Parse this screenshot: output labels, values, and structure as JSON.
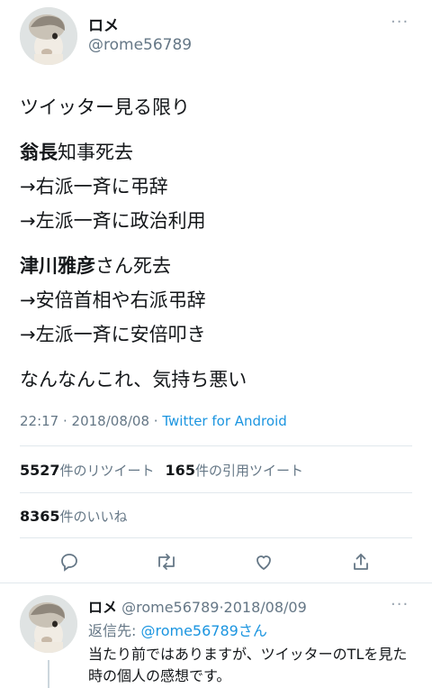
{
  "tweet": {
    "display_name": "ロメ",
    "handle": "@rome56789",
    "more_glyph": "···",
    "lines": [
      {
        "bold": "",
        "text": "ツイッター見る限り"
      },
      {
        "bold": "翁長",
        "text": "知事死去"
      },
      {
        "bold": "",
        "text": "→右派一斉に弔辞"
      },
      {
        "bold": "",
        "text": "→左派一斉に政治利用"
      },
      {
        "bold": "津川雅彦",
        "text": "さん死去"
      },
      {
        "bold": "",
        "text": "→安倍首相や右派弔辞"
      },
      {
        "bold": "",
        "text": "→左派一斉に安倍叩き"
      },
      {
        "bold": "",
        "text": "なんなんこれ、気持ち悪い"
      }
    ],
    "time": "22:17",
    "separator": " · ",
    "date": "2018/08/08",
    "app": "Twitter for Android",
    "retweets_count": "5527",
    "retweets_label": "件のリツイート",
    "quotes_count": "165",
    "quotes_label": "件の引用ツイート",
    "likes_count": "8365",
    "likes_label": "件のいいね"
  },
  "actions": {
    "reply_icon": "reply-icon",
    "retweet_icon": "retweet-icon",
    "like_icon": "heart-icon",
    "share_icon": "share-icon"
  },
  "reply": {
    "display_name": "ロメ",
    "handle": "@rome56789",
    "separator": "·",
    "date": "2018/08/09",
    "more_glyph": "···",
    "replying_prefix": "返信先: ",
    "replying_to": "@rome56789",
    "replying_suffix": "さん",
    "text": "当たり前ではありますが、ツイッターのTLを見た時の個人の感想です。"
  },
  "colors": {
    "text": "#14171a",
    "secondary": "#657786",
    "link": "#1b95e0",
    "border": "#e1e8ed"
  }
}
